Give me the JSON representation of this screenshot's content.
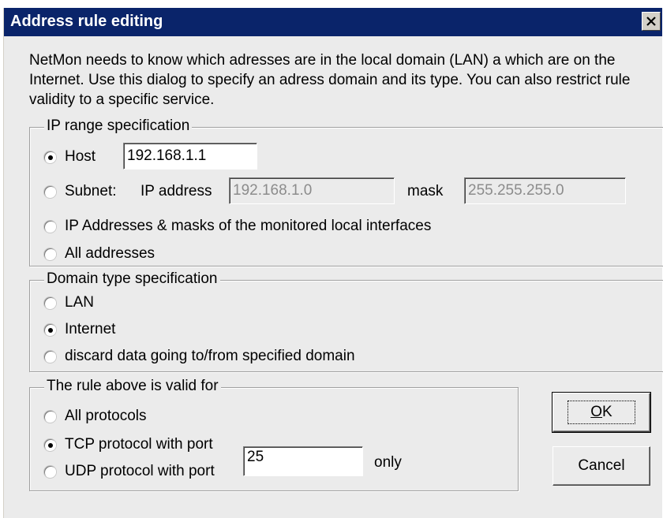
{
  "window": {
    "title": "Address rule editing",
    "close_label": "×"
  },
  "description": "NetMon needs to know which adresses are in the local domain  (LAN) a which are on the Internet. Use this dialog to specify an adress domain and its type. You can also restrict rule validity to a specific service.",
  "ip_range": {
    "legend": "IP range specification",
    "host": {
      "label": "Host",
      "value": "192.168.1.1",
      "checked": true
    },
    "subnet": {
      "label": "Subnet:",
      "ip_label": "IP address",
      "ip_value": "192.168.1.0",
      "mask_label": "mask",
      "mask_value": "255.255.255.0",
      "checked": false
    },
    "monitored": {
      "label": "IP Addresses & masks of the monitored local interfaces",
      "checked": false
    },
    "all": {
      "label": "All addresses",
      "checked": false
    }
  },
  "domain_type": {
    "legend": "Domain type specification",
    "lan": {
      "label": "LAN",
      "checked": false
    },
    "internet": {
      "label": "Internet",
      "checked": true
    },
    "discard": {
      "label": "discard data going to/from specified domain",
      "checked": false
    }
  },
  "validity": {
    "legend": "The rule above is valid for",
    "all_protocols": {
      "label": "All protocols",
      "checked": false
    },
    "tcp": {
      "label": "TCP protocol with port",
      "checked": true
    },
    "udp": {
      "label": "UDP protocol with port",
      "checked": false
    },
    "port_value": "25",
    "only_label": "only"
  },
  "buttons": {
    "ok_mnemonic": "O",
    "ok_rest": "K",
    "cancel": "Cancel"
  }
}
